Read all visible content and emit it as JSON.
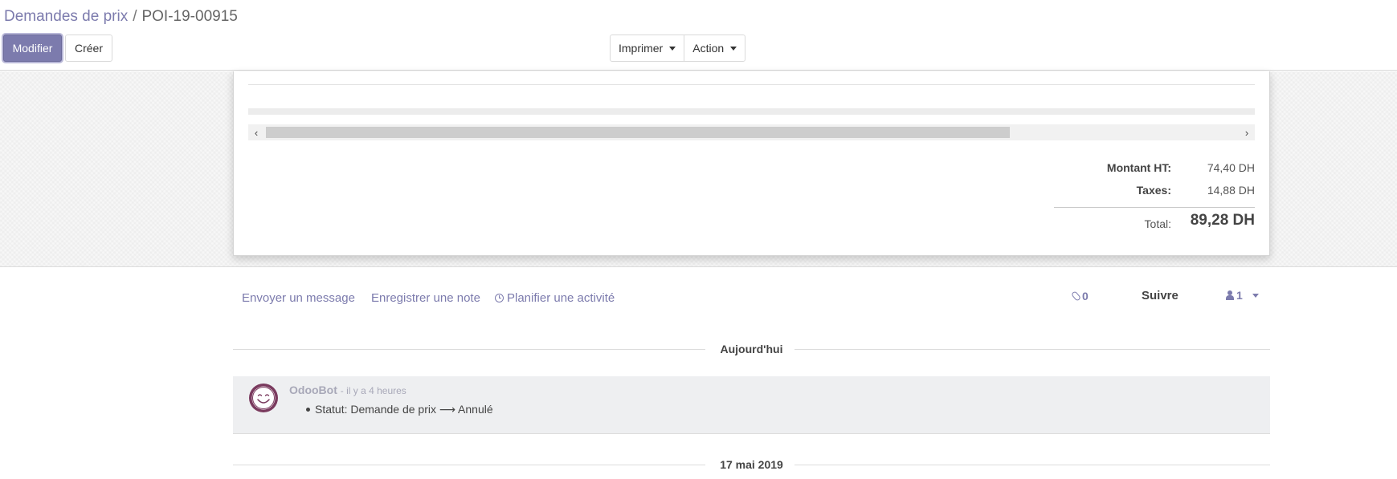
{
  "breadcrumb": {
    "parent": "Demandes de prix",
    "separator": "/",
    "current": "POI-19-00915"
  },
  "buttons": {
    "edit": "Modifier",
    "create": "Créer",
    "print": "Imprimer",
    "action": "Action"
  },
  "totals": {
    "untaxed_label": "Montant HT:",
    "untaxed_value": "74,40 DH",
    "taxes_label": "Taxes:",
    "taxes_value": "14,88 DH",
    "total_label": "Total:",
    "total_value": "89,28 DH"
  },
  "chatter": {
    "send_message": "Envoyer un message",
    "log_note": "Enregistrer une note",
    "schedule_activity": "Planifier une activité",
    "attachments_count": "0",
    "follow": "Suivre",
    "followers_count": "1"
  },
  "thread": {
    "today_label": "Aujourd'hui",
    "message": {
      "author": "OdooBot",
      "time": "- il y a 4 heures",
      "tracking": "Statut: Demande de prix ⟶ Annulé"
    },
    "older_date_label": "17 mai 2019"
  },
  "colors": {
    "accent": "#7c7bad",
    "avatar": "#7a3a5e",
    "message_bg": "#eeeff1"
  },
  "icons": {
    "attachments": "paperclip-icon",
    "followers": "user-icon",
    "activity": "clock-icon",
    "avatar": "smiley-face-icon"
  }
}
